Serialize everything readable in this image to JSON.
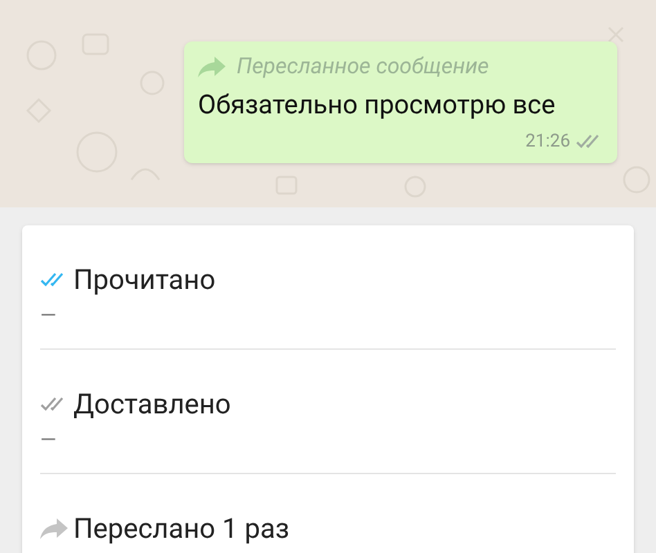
{
  "message": {
    "forwarded_label": "Пересланное сообщение",
    "text": "Обязательно просмотрю все",
    "time": "21:26"
  },
  "info": [
    {
      "kind": "read",
      "label": "Прочитано",
      "value": "—"
    },
    {
      "kind": "delivered",
      "label": "Доставлено",
      "value": "—"
    },
    {
      "kind": "forwarded",
      "label": "Переслано 1 раз"
    }
  ]
}
